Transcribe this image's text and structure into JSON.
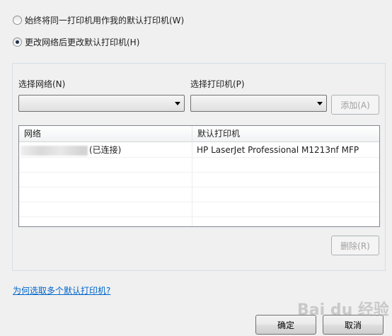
{
  "options": {
    "always_same": "始终将同一打印机用作我的默认打印机(W)",
    "change_by_network": "更改网络后更改默认打印机(H)",
    "selected": "change_by_network"
  },
  "selectors": {
    "network_label": "选择网络(N)",
    "printer_label": "选择打印机(P)",
    "network_value": "",
    "printer_value": "",
    "add_button": "添加(A)"
  },
  "table": {
    "headers": [
      "网络",
      "默认打印机"
    ],
    "rows": [
      {
        "network_suffix": "(已连接)",
        "printer": "HP LaserJet Professional M1213nf MFP"
      }
    ]
  },
  "remove_button": "删除(R)",
  "help_link": "为何选取多个默认打印机?",
  "ok_button": "确定",
  "cancel_button": "取消",
  "watermark": "Bai du 经验"
}
